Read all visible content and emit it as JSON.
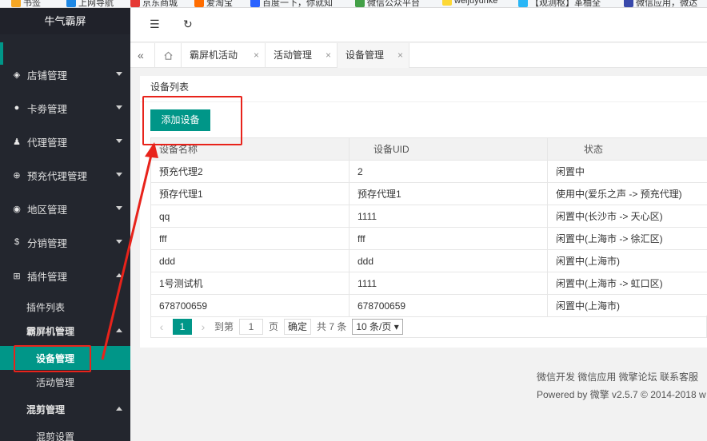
{
  "bookmarks": [
    {
      "label": "书签",
      "color": "#f5a623"
    },
    {
      "label": "上网导航",
      "color": "#1e88e5"
    },
    {
      "label": "京东商城",
      "color": "#e53935"
    },
    {
      "label": "爱淘宝",
      "color": "#ff6d00"
    },
    {
      "label": "百度一下，你就知",
      "color": "#2962ff"
    },
    {
      "label": "微信公众平台",
      "color": "#43a047"
    },
    {
      "label": "weijuyunke",
      "color": "#fdd835"
    },
    {
      "label": "【观测枢】革柚全",
      "color": "#29b6f6"
    },
    {
      "label": "微信应用，微达",
      "color": "#3949ab"
    }
  ],
  "sidebar": {
    "logo": "牛气霸屏",
    "items": [
      {
        "label": "店铺管理",
        "icon": "cube-icon"
      },
      {
        "label": "卡劵管理",
        "icon": "disc-icon"
      },
      {
        "label": "代理管理",
        "icon": "user-icon"
      },
      {
        "label": "预充代理管理",
        "icon": "plus-circle-icon"
      },
      {
        "label": "地区管理",
        "icon": "compass-icon"
      },
      {
        "label": "分销管理",
        "icon": "dollar-icon"
      },
      {
        "label": "插件管理",
        "icon": "grid-icon"
      }
    ],
    "sub_items": {
      "plugin_list": "插件列表",
      "bapingji": "霸屏机管理",
      "device": "设备管理",
      "activity": "活动管理",
      "hunjian": "混剪管理",
      "hunjian_setting": "混剪设置"
    }
  },
  "topbar": {
    "collapse_icon": "☰",
    "refresh_icon": "↻"
  },
  "tabs": {
    "home_icon": "home-icon",
    "items": [
      {
        "label": "霸屏机活动",
        "close": "×"
      },
      {
        "label": "活动管理",
        "close": "×"
      },
      {
        "label": "设备管理",
        "close": "×"
      }
    ]
  },
  "card": {
    "title": "设备列表",
    "add_button": "添加设备",
    "columns": [
      "设备名称",
      "设备UID",
      "状态"
    ],
    "rows": [
      [
        "预充代理2",
        "2",
        "闲置中"
      ],
      [
        "预存代理1",
        "预存代理1",
        "使用中(爱乐之声 -> 预充代理)"
      ],
      [
        "qq",
        "1111",
        "闲置中(长沙市 -> 天心区)"
      ],
      [
        "fff",
        "fff",
        "闲置中(上海市 -> 徐汇区)"
      ],
      [
        "ddd",
        "ddd",
        "闲置中(上海市)"
      ],
      [
        "1号测试机",
        "1111",
        "闲置中(上海市 -> 虹口区)"
      ],
      [
        "678700659",
        "678700659",
        "闲置中(上海市)"
      ]
    ]
  },
  "pager": {
    "prev": "‹",
    "current": "1",
    "next": "›",
    "goto_label": "到第",
    "goto_value": "1",
    "page_unit": "页",
    "confirm": "确定",
    "total": "共 7 条",
    "per_page": "10 条/页"
  },
  "footer": {
    "links": "微信开发 微信应用 微擎论坛 联系客服",
    "powered": "Powered by 微擎 v2.5.7 © 2014-2018 w"
  },
  "annotation_color": "#e8231b"
}
